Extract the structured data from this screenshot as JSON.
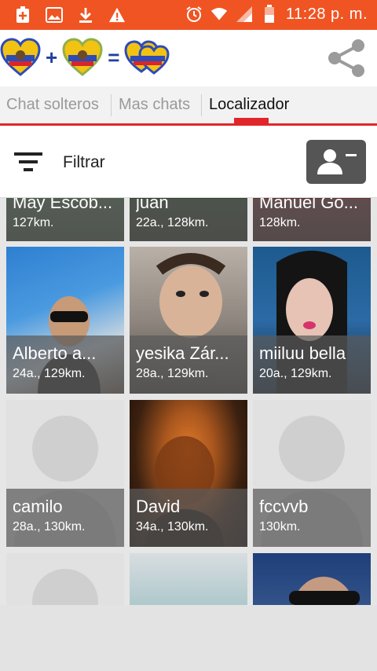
{
  "status_bar": {
    "time": "11:28 p. m.",
    "left_icons": [
      "add-box-icon",
      "image-icon",
      "download-icon",
      "warning-icon"
    ],
    "right_icons": [
      "alarm-icon",
      "wifi-icon",
      "signal-icon",
      "battery-icon"
    ],
    "color": "#f05423"
  },
  "app_bar": {
    "equation": [
      "+",
      "="
    ],
    "share_icon": "share-icon"
  },
  "tabs": [
    {
      "label": "Chat solteros",
      "active": false
    },
    {
      "label": "Mas chats",
      "active": false
    },
    {
      "label": "Localizador",
      "active": true
    }
  ],
  "filter": {
    "label": "Filtrar"
  },
  "profiles": [
    {
      "name": "May Escob...",
      "meta": "127km.",
      "photo": "partial"
    },
    {
      "name": "juan",
      "meta": "22a., 128km.",
      "photo": "partial"
    },
    {
      "name": "Manuel Go...",
      "meta": "128km.",
      "photo": "partial"
    },
    {
      "name": "Alberto a...",
      "meta": "24a., 129km.",
      "photo": "photo"
    },
    {
      "name": "yesika Zár...",
      "meta": "28a., 129km.",
      "photo": "photo"
    },
    {
      "name": "miiluu bella",
      "meta": "20a., 129km.",
      "photo": "photo"
    },
    {
      "name": "camilo",
      "meta": "28a., 130km.",
      "photo": "placeholder"
    },
    {
      "name": "David",
      "meta": "34a., 130km.",
      "photo": "photo"
    },
    {
      "name": "fccvvb",
      "meta": "130km.",
      "photo": "placeholder"
    }
  ]
}
